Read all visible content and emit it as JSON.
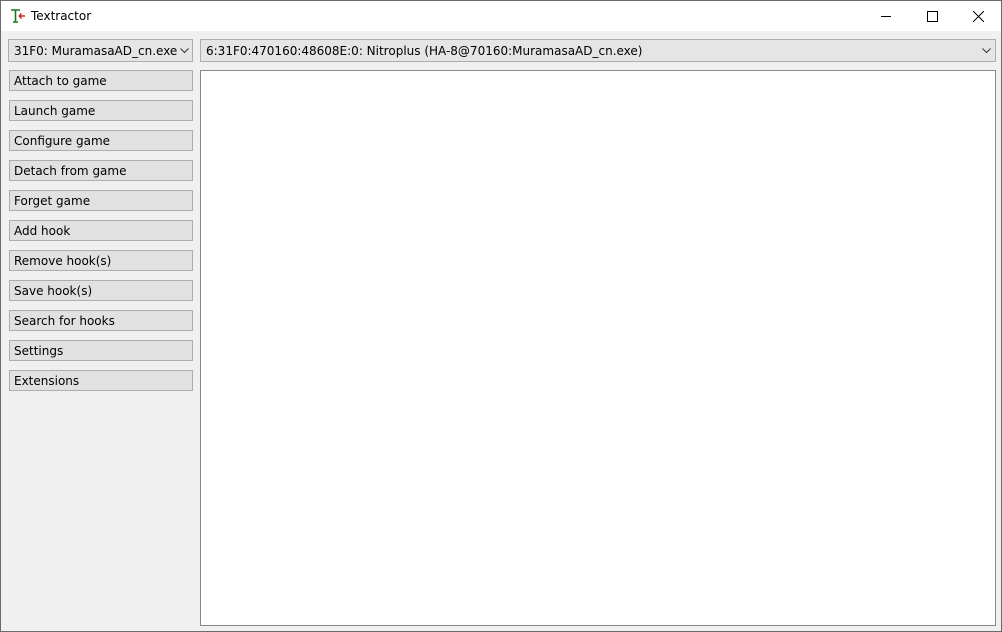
{
  "window": {
    "title": "Textractor",
    "icon": "textractor-icon"
  },
  "window_controls": {
    "minimize_icon": "minimize-icon",
    "maximize_icon": "maximize-icon",
    "close_icon": "close-icon"
  },
  "process_select": {
    "value": "31F0: MuramasaAD_cn.exe",
    "icon": "chevron-down-icon"
  },
  "hook_select": {
    "value": "6:31F0:470160:48608E:0: Nitroplus (HA-8@70160:MuramasaAD_cn.exe)",
    "icon": "chevron-down-icon"
  },
  "sidebar": {
    "buttons": [
      {
        "label": "Attach to game"
      },
      {
        "label": "Launch game"
      },
      {
        "label": "Configure game"
      },
      {
        "label": "Detach from game"
      },
      {
        "label": "Forget game"
      },
      {
        "label": "Add hook"
      },
      {
        "label": "Remove hook(s)"
      },
      {
        "label": "Save hook(s)"
      },
      {
        "label": "Search for hooks"
      },
      {
        "label": "Settings"
      },
      {
        "label": "Extensions"
      }
    ]
  },
  "output": {
    "text": ""
  }
}
